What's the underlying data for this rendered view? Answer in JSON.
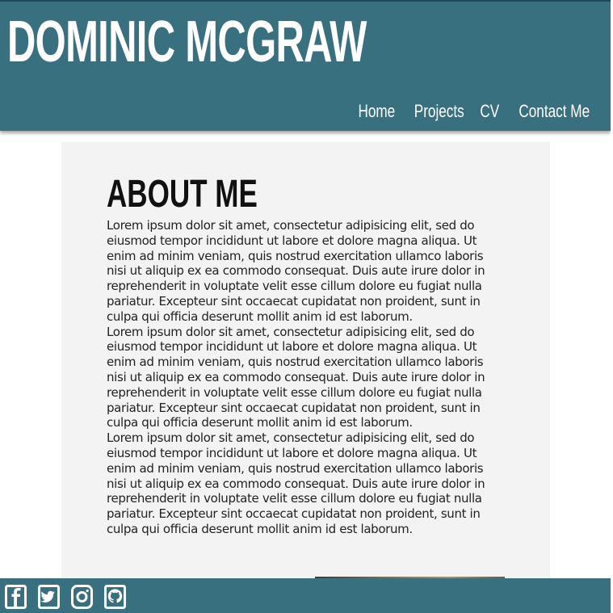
{
  "header": {
    "site_title": "DOMINIC MCGRAW",
    "nav": {
      "home": "Home",
      "projects": "Projects",
      "cv": "CV",
      "contact": "Contact Me"
    }
  },
  "main": {
    "heading": "ABOUT ME",
    "paragraphs": [
      "Lorem ipsum dolor sit amet, consectetur adipisicing elit, sed do eiusmod tempor incididunt ut labore et dolore magna aliqua. Ut enim ad minim veniam, quis nostrud exercitation ullamco laboris nisi ut aliquip ex ea commodo consequat. Duis aute irure dolor in reprehenderit in voluptate velit esse cillum dolore eu fugiat nulla pariatur. Excepteur sint occaecat cupidatat non proident, sunt in culpa qui officia deserunt mollit anim id est laborum.",
      "Lorem ipsum dolor sit amet, consectetur adipisicing elit, sed do eiusmod tempor incididunt ut labore et dolore magna aliqua. Ut enim ad minim veniam, quis nostrud exercitation ullamco laboris nisi ut aliquip ex ea commodo consequat. Duis aute irure dolor in reprehenderit in voluptate velit esse cillum dolore eu fugiat nulla pariatur. Excepteur sint occaecat cupidatat non proident, sunt in culpa qui officia deserunt mollit anim id est laborum.",
      "Lorem ipsum dolor sit amet, consectetur adipisicing elit, sed do eiusmod tempor incididunt ut labore et dolore magna aliqua. Ut enim ad minim veniam, quis nostrud exercitation ullamco laboris nisi ut aliquip ex ea commodo consequat. Duis aute irure dolor in reprehenderit in voluptate velit esse cillum dolore eu fugiat nulla pariatur. Excepteur sint occaecat cupidatat non proident, sunt in culpa qui officia deserunt mollit anim id est laborum."
    ]
  },
  "footer": {
    "social_icons": [
      "facebook-icon",
      "twitter-icon",
      "instagram-icon",
      "github-icon"
    ]
  },
  "colors": {
    "header_bg": "#39707f",
    "content_bg": "#f3f3f3",
    "text": "#222222",
    "nav_text": "#ffffff"
  }
}
